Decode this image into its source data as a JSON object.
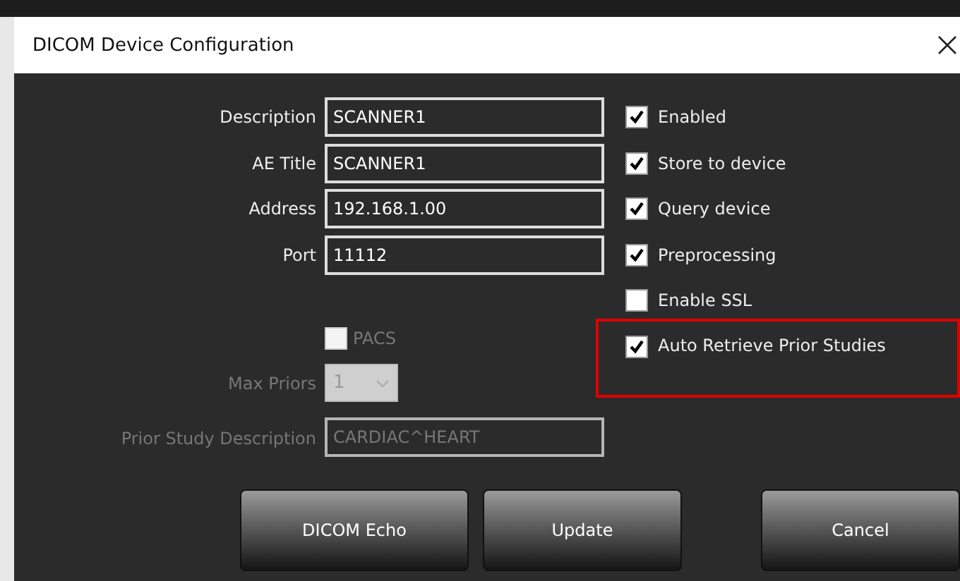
{
  "window": {
    "title": "DICOM Device Configuration"
  },
  "fields": [
    {
      "label": "Description",
      "value": "SCANNER1"
    },
    {
      "label": "AE Title",
      "value": "SCANNER1"
    },
    {
      "label": "Address",
      "value": "192.168.1.00"
    },
    {
      "label": "Port",
      "value": "11112"
    }
  ],
  "pacs": {
    "label": "PACS",
    "checked": false,
    "disabled": true
  },
  "max_priors": {
    "label": "Max Priors",
    "value": "1",
    "disabled": true
  },
  "prior_study_description": {
    "label": "Prior Study Description",
    "value": "CARDIAC^HEART",
    "disabled": true
  },
  "options": [
    {
      "label": "Enabled",
      "checked": true,
      "highlighted": false
    },
    {
      "label": "Store to device",
      "checked": true,
      "highlighted": false
    },
    {
      "label": "Query device",
      "checked": true,
      "highlighted": false
    },
    {
      "label": "Preprocessing",
      "checked": true,
      "highlighted": false
    },
    {
      "label": "Enable SSL",
      "checked": false,
      "highlighted": false
    },
    {
      "label": "Auto Retrieve Prior Studies",
      "checked": true,
      "highlighted": true
    }
  ],
  "buttons": [
    "DICOM Echo",
    "Update",
    "Cancel"
  ]
}
